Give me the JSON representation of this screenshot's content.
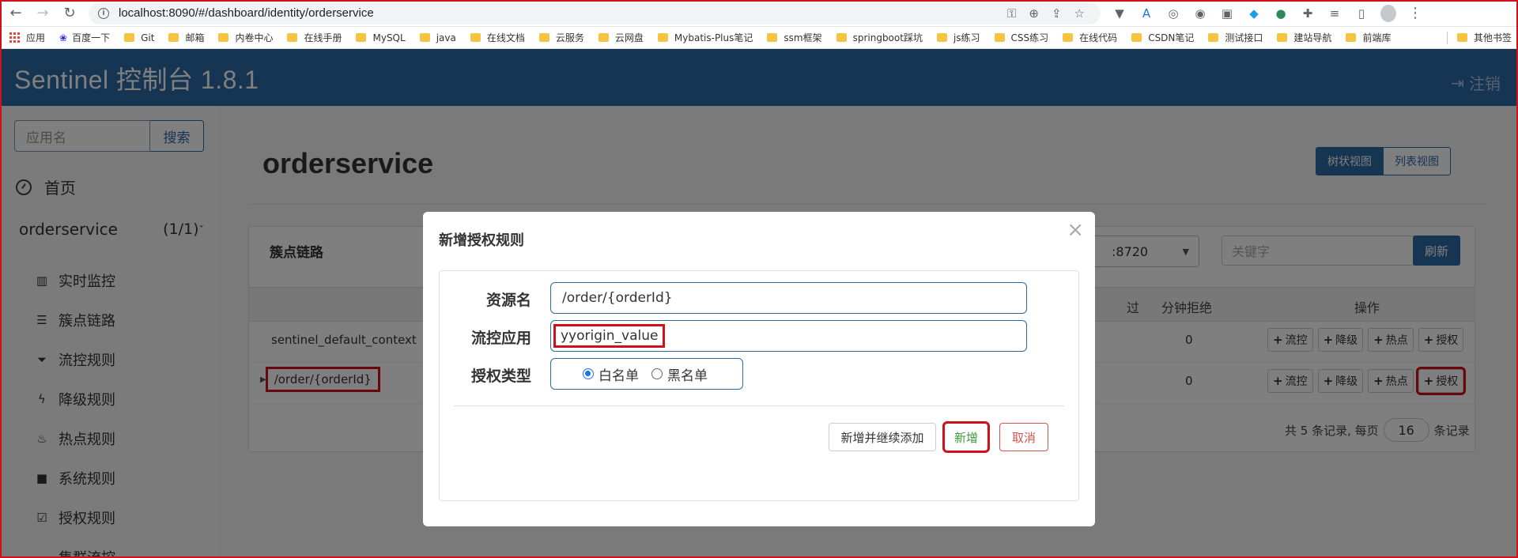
{
  "browser": {
    "url": "localhost:8090/#/dashboard/identity/orderservice",
    "bookmarks": [
      "应用",
      "百度一下",
      "Git",
      "邮箱",
      "内卷中心",
      "在线手册",
      "MySQL",
      "java",
      "在线文档",
      "云服务",
      "云网盘",
      "Mybatis-Plus笔记",
      "ssm框架",
      "springboot踩坑",
      "js练习",
      "CSS练习",
      "在线代码",
      "CSDN笔记",
      "测试接口",
      "建站导航",
      "前端库"
    ],
    "more_bookmarks": "其他书签"
  },
  "header": {
    "title": "Sentinel 控制台 1.8.1",
    "logout": "注销"
  },
  "sidebar": {
    "search_placeholder": "应用名",
    "search_button": "搜索",
    "home": "首页",
    "app_name": "orderservice",
    "app_count": "(1/1)",
    "items": [
      {
        "label": "实时监控",
        "icon": "bar-chart-icon"
      },
      {
        "label": "簇点链路",
        "icon": "list-icon"
      },
      {
        "label": "流控规则",
        "icon": "filter-icon"
      },
      {
        "label": "降级规则",
        "icon": "flash-icon"
      },
      {
        "label": "热点规则",
        "icon": "fire-icon"
      },
      {
        "label": "系统规则",
        "icon": "lock-icon"
      },
      {
        "label": "授权规则",
        "icon": "check-square-icon"
      },
      {
        "label": "集群流控",
        "icon": "cloud-icon"
      }
    ]
  },
  "main": {
    "page_title": "orderservice",
    "view_tree": "树状视图",
    "view_list": "列表视图",
    "panel_title": "簇点链路",
    "host_value": ":8720",
    "keyword_placeholder": "关键字",
    "refresh": "刷新",
    "columns": {
      "pass": "过",
      "reject": "分钟拒绝",
      "ops": "操作"
    },
    "rows": [
      {
        "name": "sentinel_default_context",
        "reject": "0"
      },
      {
        "name": "/order/{orderId}",
        "reject": "0"
      }
    ],
    "op_buttons": [
      "流控",
      "降级",
      "热点",
      "授权"
    ],
    "pagination": {
      "prefix": "共 5 条记录, 每页",
      "page_size": "16",
      "suffix": "条记录"
    }
  },
  "modal": {
    "title": "新增授权规则",
    "close": "×",
    "resource_label": "资源名",
    "resource_value": "/order/{orderId}",
    "limit_app_label": "流控应用",
    "limit_app_value": "yyorigin_value",
    "auth_type_label": "授权类型",
    "whitelist": "白名单",
    "blacklist": "黑名单",
    "btn_add_continue": "新增并继续添加",
    "btn_add": "新增",
    "btn_cancel": "取消"
  },
  "colors": {
    "brand": "#2d6aa6",
    "highlight": "#d0111b",
    "success": "#4cae4c",
    "danger": "#d9534f"
  }
}
